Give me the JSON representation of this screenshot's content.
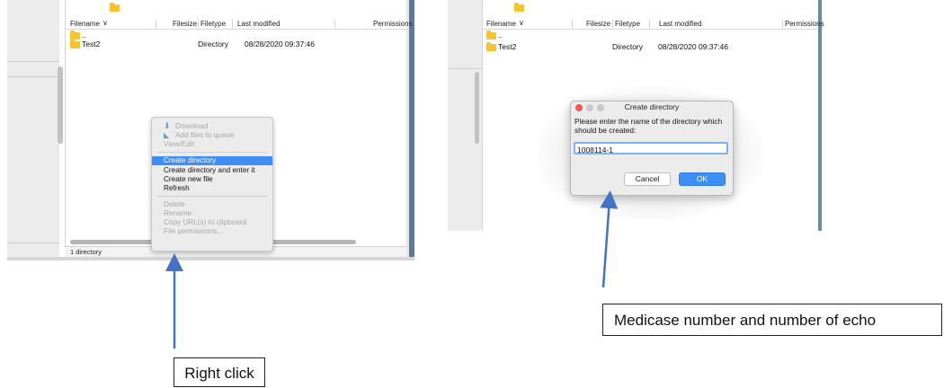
{
  "left_panel": {
    "headers": {
      "filename": "Filename",
      "filesize": "Filesize",
      "filetype": "Filetype",
      "modified": "Last modified",
      "permissions": "Permissions"
    },
    "rows": [
      {
        "name": "..",
        "type": "",
        "modified": ""
      },
      {
        "name": "Test2",
        "type": "Directory",
        "modified": "08/28/2020 09:37:46"
      }
    ],
    "status": "1 directory",
    "context_menu": {
      "items": [
        {
          "label": "Download",
          "state": "disabled"
        },
        {
          "label": "Add files to queue",
          "state": "disabled"
        },
        {
          "label": "View/Edit",
          "state": "disabled"
        },
        {
          "label": "Create directory",
          "state": "highlighted"
        },
        {
          "label": "Create directory and enter it",
          "state": "enabled"
        },
        {
          "label": "Create new file",
          "state": "enabled"
        },
        {
          "label": "Refresh",
          "state": "enabled"
        },
        {
          "label": "Delete",
          "state": "disabled"
        },
        {
          "label": "Rename",
          "state": "disabled"
        },
        {
          "label": "Copy URL(s) to clipboard",
          "state": "disabled"
        },
        {
          "label": "File permissions...",
          "state": "disabled"
        }
      ]
    }
  },
  "right_panel": {
    "headers": {
      "filename": "Filename",
      "filesize": "Filesize",
      "filetype": "Filetype",
      "modified": "Last modified",
      "permissions": "Permissions"
    },
    "rows": [
      {
        "name": "..",
        "type": "",
        "modified": ""
      },
      {
        "name": "Test2",
        "type": "Directory",
        "modified": "08/28/2020 09:37:46"
      }
    ],
    "dialog": {
      "title": "Create directory",
      "message": "Please enter the name of the directory which should be created:",
      "input_value": "1008114-1",
      "cancel_label": "Cancel",
      "ok_label": "OK"
    }
  },
  "annotations": {
    "left_callout": "Right click",
    "right_callout": "Medicase number and number of echo",
    "arrow_color": "#4472c4"
  },
  "colors": {
    "highlight": "#3f8ef5",
    "folder": "#f6c431",
    "ok_button": "#3d8ff5"
  }
}
